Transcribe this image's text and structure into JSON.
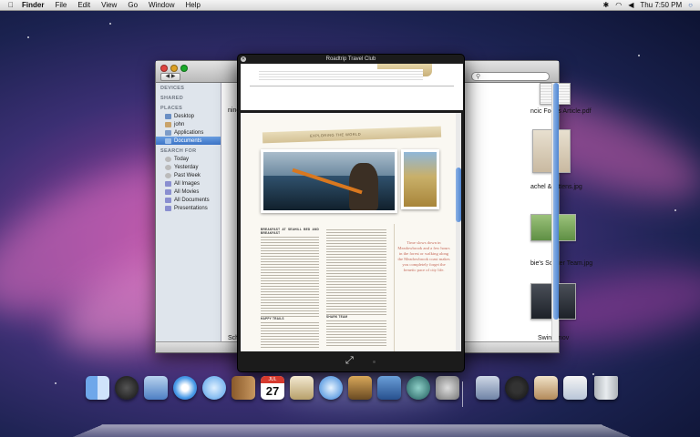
{
  "menubar": {
    "app": "Finder",
    "menus": [
      "File",
      "Edit",
      "View",
      "Go",
      "Window",
      "Help"
    ],
    "clock": "Thu 7:50 PM"
  },
  "finder": {
    "sidebar": {
      "devices_header": "DEVICES",
      "shared_header": "SHARED",
      "places_header": "PLACES",
      "places": [
        "Desktop",
        "john",
        "Applications",
        "Documents"
      ],
      "selected": "Documents",
      "search_header": "SEARCH FOR",
      "searches": [
        "Today",
        "Yesterday",
        "Past Week",
        "All Images",
        "All Movies",
        "All Documents",
        "Presentations"
      ]
    },
    "files": {
      "partial_left_top": "nine",
      "partial_left_bottom": "Schu",
      "right": [
        "ncic Foods Article.pdf",
        "achel & kittens.jpg",
        "bie's Soccer Team.jpg",
        "Swing.mov"
      ]
    }
  },
  "quicklook": {
    "title": "Roadtrip Travel Club",
    "page2": {
      "banner": "EXPLORING THE WORLD",
      "col1_heading": "BREAKFAST AT SEAHILL BED AND BREAKFAST",
      "col1_heading2": "HAPPY TRAILS",
      "col2_heading": "SHARK TEAM",
      "pull_quote": "Time slows down in Meadowbrook and a few hours in the forest or walking along the Meadowbrook coast makes you completely forget the frenetic pace of city life."
    }
  },
  "colors": {
    "selection": "#3d74c7",
    "pull_quote": "#c56a5a"
  },
  "dock": {
    "icons": [
      "finder-icon",
      "dashboard-icon",
      "mail-icon",
      "safari-icon",
      "ichat-icon",
      "address-book-icon",
      "ical-icon",
      "preview-icon",
      "itunes-icon",
      "iphoto-icon",
      "spaces-icon",
      "time-machine-icon",
      "system-preferences-icon",
      "pictures-stack-icon",
      "photo-booth-icon",
      "downloads-stack-icon",
      "documents-stack-icon",
      "trash-icon"
    ],
    "calendar_day": "27",
    "calendar_month": "JUL"
  }
}
